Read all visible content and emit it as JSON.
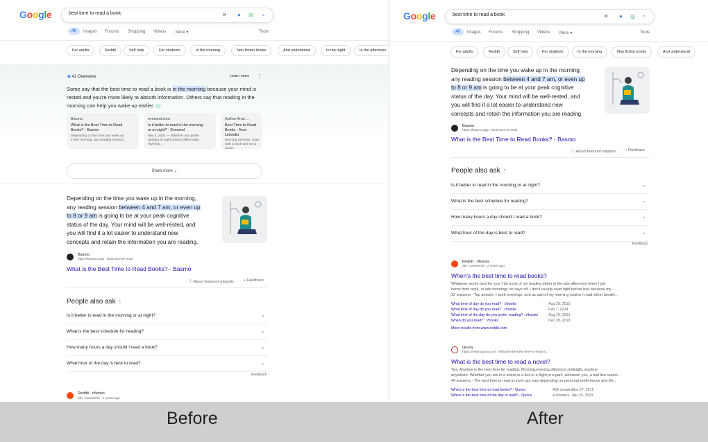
{
  "query": "best time to read a book",
  "logo_letters": [
    "G",
    "o",
    "o",
    "g",
    "l",
    "e"
  ],
  "tabs": [
    "All",
    "Images",
    "Forums",
    "Shopping",
    "Videos",
    "More",
    "Tools"
  ],
  "chips_left": [
    "For adults",
    "Reddit",
    "Self help",
    "For students",
    "In the morning",
    "Non fiction books",
    "And understand",
    "In the night",
    "In the afternoon"
  ],
  "chips_right": [
    "For adults",
    "Reddit",
    "Self help",
    "For students",
    "In the morning",
    "Non fiction books",
    "And understand"
  ],
  "ai": {
    "label": "AI Overview",
    "learn_more": "Learn more",
    "text_pre": "Some say that the best time to read a book is ",
    "text_hl": "in the morning",
    "text_post": " because your mind is rested and you're more likely to absorb information. Others say that reading in the morning can help you wake up earlier.",
    "cards": [
      {
        "source": "Basmo",
        "title": "What is the Best Time to Read Books? - Basmo",
        "snippet": "Depending on the time you wake up in the morning, any reading session..."
      },
      {
        "source": "everand.com",
        "title": "Is it better to read in the morning or at night? - Everand",
        "snippet": "Mar 6, 2024 — Whether you prefer reading at night doesn't affect daily rhythms..."
      },
      {
        "source": "Author Arun ...",
        "title": "Best Time to Read Books - Arun Linkedin",
        "snippet": "Morning Serenity: Start with a book can set a good..."
      }
    ],
    "show_more": "Show more"
  },
  "featured": {
    "l1": "Depending on the time you wake up in the morning,",
    "l2_pre": "any reading session ",
    "l2_hl": "between 4 and 7 am, or even up",
    "l3_hl": "to 8 or 9 am",
    "l3_post": " is going to be at your peak cognitive",
    "l4": "status of the day. Your mind will be well-rested, and",
    "l5": "you will find it a lot easier to understand new",
    "l6": "concepts and retain the information you are reading.",
    "source": "Basmo",
    "url": "https://basmo.app › best-time-to-read",
    "link": "What is the Best Time to Read Books? - Basmo",
    "about": "About featured snippets",
    "feedback": "Feedback"
  },
  "paa": {
    "title": "People also ask",
    "questions": [
      "Is it better to read in the morning or at night?",
      "What is the best schedule for reading?",
      "How many hours a day should I read a book?",
      "What hour of the day is best to read?"
    ],
    "feedback": "Feedback"
  },
  "reddit": {
    "source": "Reddit · r/books",
    "meta": "35+ comments · 2 years ago",
    "title": "When's the best time to read books?",
    "snippet1": "Whatever works best for you! I do most of my reading either in the late afternoon when I get",
    "snippet2": "home from work, or late mornings on days off. I don't usually read right before bed because my...",
    "snippet3": "22 answers · Top answer: I work evenings, and as part of my morning routine I read either breakf...",
    "subs": [
      {
        "t": "What time of day do you read? : r/books",
        "d": "Aug 29, 2015"
      },
      {
        "t": "What time of day do you read? : r/books",
        "d": "Feb 7, 2024"
      },
      {
        "t": "What time of the day do you prefer reading? : r/books",
        "d": "Aug 19, 2021"
      },
      {
        "t": "When do you read? : r/books",
        "d": "Dec 28, 2018"
      }
    ],
    "more": "More results from www.reddit.com"
  },
  "quora": {
    "source": "Quora",
    "url": "https://www.quora.com › What-is-the-best-time-to-read-a...",
    "title": "What is the best time to read a novel?",
    "snippet1": "Yes. Anytime is the best time for reading. Morning,evening,afternoon,midnight, anytime",
    "snippet2": "anywhere. Whether you are in a metro,in a bus,in a flight,in a park, wherever you, a feel like readin...",
    "snippet3": "44 answers · The best time to read a novel can vary depending on personal preferences and life...",
    "subs": [
      {
        "t": "When is the best time to read books? - Quora",
        "a": "408 answers",
        "d": "Nov 27, 2015"
      },
      {
        "t": "When is the best time of the day to read? - Quora",
        "a": "4 answers",
        "d": "Apr 29, 2023"
      }
    ]
  },
  "captions": {
    "before": "Before",
    "after": "After"
  },
  "colors": {
    "blue": "#4285F4",
    "red": "#EA4335",
    "yellow": "#FBBC05",
    "green": "#34A853",
    "link": "#1a0dab",
    "highlight": "#d3e3fd"
  }
}
